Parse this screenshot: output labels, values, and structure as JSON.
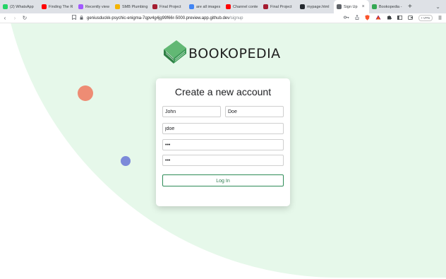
{
  "browser": {
    "tabs": [
      {
        "label": "(2) WhatsApp",
        "icon": "whatsapp-icon",
        "color": "#25d366",
        "width": 55
      },
      {
        "label": "Finding The R",
        "icon": "youtube-icon",
        "color": "#ff0000",
        "width": 52
      },
      {
        "label": "Recently view",
        "icon": "figma-icon",
        "color": "#a259ff",
        "width": 52
      },
      {
        "label": "SMB Plumbing",
        "icon": "smb-icon",
        "color": "#f4b400",
        "width": 53
      },
      {
        "label": "Final Project",
        "icon": "harvard-shield-icon",
        "color": "#a51c30",
        "width": 52
      },
      {
        "label": "are all images",
        "icon": "google-icon",
        "color": "#4285f4",
        "width": 52
      },
      {
        "label": "Channel conte",
        "icon": "youtube-icon",
        "color": "#ff0000",
        "width": 53
      },
      {
        "label": "Final Project",
        "icon": "harvard-shield-icon",
        "color": "#a51c30",
        "width": 52
      },
      {
        "label": "mypage.html",
        "icon": "github-icon",
        "color": "#24292f",
        "width": 52
      },
      {
        "label": "Sign Up",
        "icon": "globe-icon",
        "color": "#5f6368",
        "width": 50,
        "active": true
      },
      {
        "label": "Bookopedia -",
        "icon": "google-drive-icon",
        "color": "#34a853",
        "width": 50
      }
    ],
    "new_tab_label": "+",
    "tab_menu_label": "⌄",
    "url_host": "geniusduckk-psychic-enigma-7qpv4g4jg99f66r-5000.preview.app.github.dev",
    "url_path": "/signup",
    "vpn_label": "• VPN"
  },
  "app": {
    "logo_text": "BOOKOPEDIA",
    "form_title": "Create a new account",
    "first_name_value": "John",
    "last_name_value": "Doe",
    "username_value": "jdoe",
    "password_value": "•••",
    "confirm_value": "•••",
    "login_label": "Log In"
  }
}
